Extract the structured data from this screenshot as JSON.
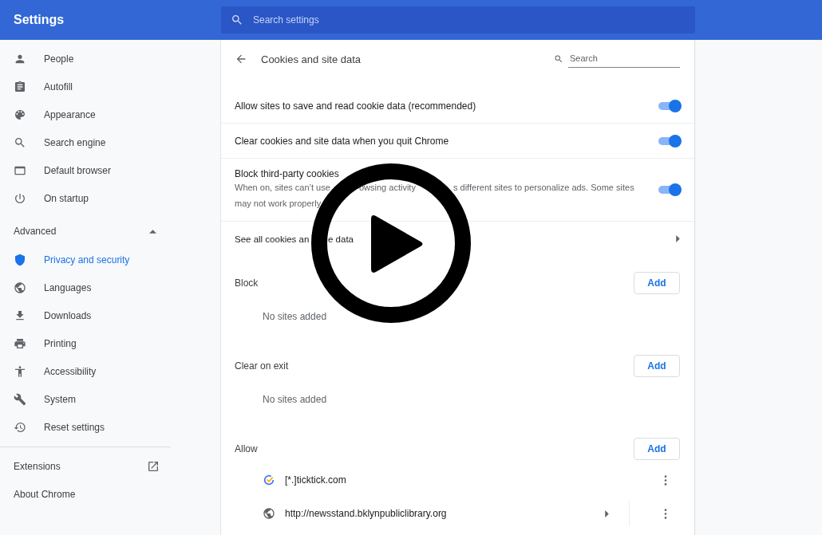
{
  "header": {
    "title": "Settings",
    "search": {
      "placeholder": "Search settings"
    }
  },
  "sidebar": {
    "items": [
      {
        "label": "People",
        "kind": "person",
        "selected": false
      },
      {
        "label": "Autofill",
        "kind": "clipboard",
        "selected": false
      },
      {
        "label": "Appearance",
        "kind": "palette",
        "selected": false
      },
      {
        "label": "Search engine",
        "kind": "search",
        "selected": false
      },
      {
        "label": "Default browser",
        "kind": "browser",
        "selected": false
      },
      {
        "label": "On startup",
        "kind": "power",
        "selected": false
      }
    ],
    "advanced": {
      "label": "Advanced",
      "expanded": true
    },
    "advanced_items": [
      {
        "label": "Privacy and security",
        "kind": "shield",
        "selected": true
      },
      {
        "label": "Languages",
        "kind": "globe",
        "selected": false
      },
      {
        "label": "Downloads",
        "kind": "download",
        "selected": false
      },
      {
        "label": "Printing",
        "kind": "printer",
        "selected": false
      },
      {
        "label": "Accessibility",
        "kind": "accessibility",
        "selected": false
      },
      {
        "label": "System",
        "kind": "wrench",
        "selected": false
      },
      {
        "label": "Reset settings",
        "kind": "history",
        "selected": false
      }
    ],
    "links": [
      {
        "label": "Extensions",
        "external": true
      },
      {
        "label": "About Chrome",
        "external": false
      }
    ]
  },
  "page": {
    "title": "Cookies and site data",
    "search": {
      "placeholder": "Search"
    },
    "settings": [
      {
        "label": "Allow sites to save and read cookie data (recommended)",
        "on": true
      },
      {
        "label": "Clear cookies and site data when you quit Chrome",
        "on": true
      },
      {
        "label": "Block third-party cookies",
        "description": [
          [
            "When on, sites can’t use",
            "owsing activity",
            "s different sites to personalize ads. Some sites"
          ],
          [
            "may not work properly"
          ]
        ],
        "on": true
      }
    ],
    "see_all": [
      "See all cookies an",
      "e data"
    ],
    "sections": [
      {
        "title": "Block",
        "button": "Add",
        "empty": "No sites added"
      },
      {
        "title": "Clear on exit",
        "button": "Add",
        "empty": "No sites added"
      },
      {
        "title": "Allow",
        "button": "Add",
        "sites": [
          {
            "kind": "ticktick",
            "address": "[*.]ticktick.com",
            "expandable": false
          },
          {
            "kind": "globe",
            "address": "http://newsstand.bklynpubliclibrary.org",
            "expandable": true
          }
        ]
      }
    ]
  },
  "overlay": {
    "kind": "play"
  }
}
